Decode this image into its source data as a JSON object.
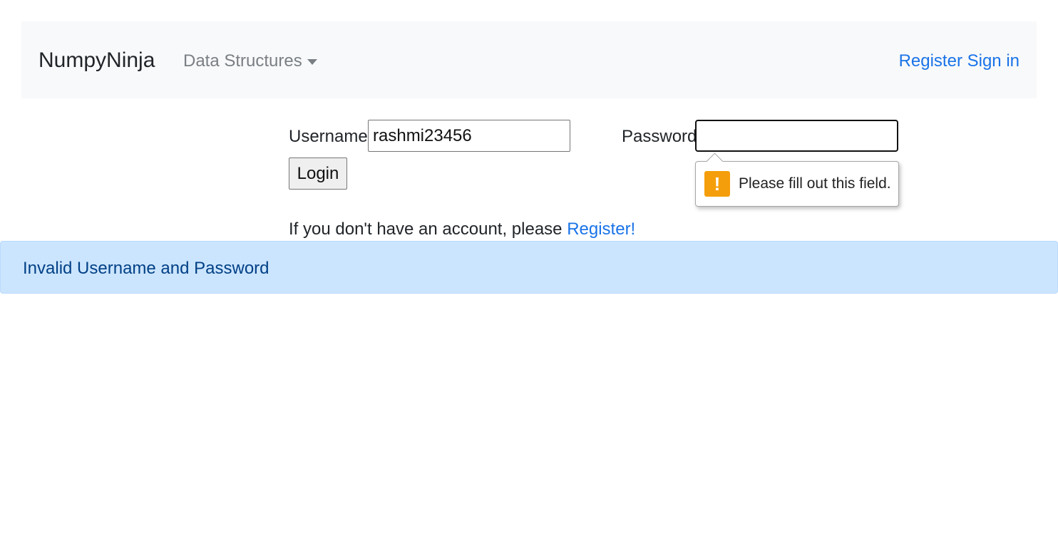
{
  "navbar": {
    "brand": "NumpyNinja",
    "dropdown_label": "Data Structures",
    "register_link": "Register",
    "signin_link": "Sign in"
  },
  "form": {
    "username_label": "Username:",
    "username_value": "rashmi23456",
    "password_label": "Password:",
    "password_value": "",
    "login_button": "Login"
  },
  "validation": {
    "message": "Please fill out this field.",
    "icon": "!",
    "icon_color": "#f59e0b"
  },
  "account": {
    "prompt": "If you don't have an account, please ",
    "register_link": "Register!"
  },
  "alert": {
    "message": "Invalid Username and Password",
    "background": "#cce5ff"
  },
  "colors": {
    "link": "#1a73e8",
    "navbar_bg": "#f8f9fa"
  }
}
